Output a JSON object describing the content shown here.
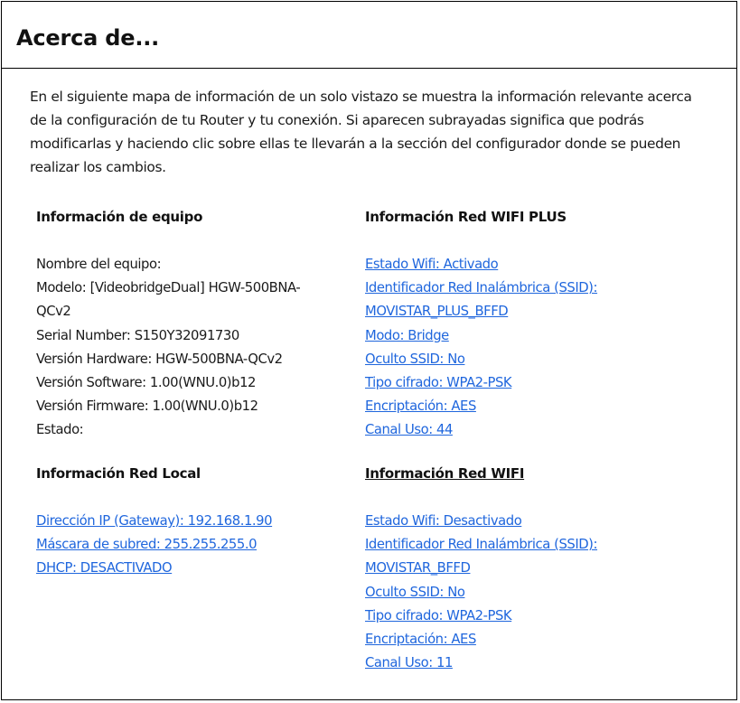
{
  "title": "Acerca de...",
  "intro": "En el siguiente mapa de información de un solo vistazo se muestra la información relevante acerca de la configuración de tu Router y tu conexión. Si aparecen subrayadas significa que podrás modificarlas y haciendo clic sobre ellas te llevarán a la sección del configurador donde se pueden realizar los cambios.",
  "equipo": {
    "heading": "Información de equipo",
    "lines": [
      "Nombre del equipo:",
      "Modelo: [VideobridgeDual] HGW-500BNA-",
      "QCv2",
      "Serial Number: S150Y32091730",
      "Versión Hardware: HGW-500BNA-QCv2",
      "Versión Software: 1.00(WNU.0)b12",
      "Versión Firmware: 1.00(WNU.0)b12",
      "Estado:"
    ]
  },
  "wifi_plus": {
    "heading": "Información Red WIFI PLUS",
    "links": [
      "Estado Wifi: Activado",
      "Identificador Red Inalámbrica (SSID):",
      "MOVISTAR_PLUS_BFFD",
      "Modo: Bridge",
      "Oculto SSID: No",
      "Tipo cifrado: WPA2-PSK",
      "Encriptación: AES",
      "Canal Uso: 44"
    ]
  },
  "red_local": {
    "heading": "Información Red Local",
    "links": [
      "Dirección IP (Gateway): 192.168.1.90",
      "Máscara de subred: 255.255.255.0",
      "DHCP: DESACTIVADO"
    ]
  },
  "wifi": {
    "heading": "Información Red WIFI",
    "links": [
      "Estado Wifi: Desactivado",
      "Identificador Red Inalámbrica (SSID):",
      "MOVISTAR_BFFD",
      "Oculto SSID: No",
      "Tipo cifrado: WPA2-PSK",
      "Encriptación: AES",
      "Canal Uso: 11"
    ]
  },
  "colors": {
    "link": "#1f66dd",
    "text": "#1a1a1a",
    "border": "#000000"
  }
}
